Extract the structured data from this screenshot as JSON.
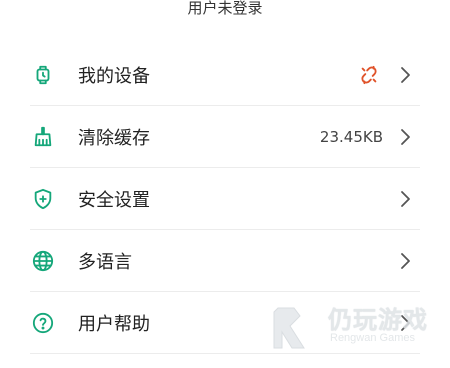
{
  "header": {
    "title": "用户未登录"
  },
  "menu": {
    "items": [
      {
        "label": "我的设备",
        "value": "",
        "icon": "watch-icon",
        "status_icon": "broken-link-icon"
      },
      {
        "label": "清除缓存",
        "value": "23.45KB",
        "icon": "broom-icon"
      },
      {
        "label": "安全设置",
        "value": "",
        "icon": "shield-icon"
      },
      {
        "label": "多语言",
        "value": "",
        "icon": "globe-icon"
      },
      {
        "label": "用户帮助",
        "value": "",
        "icon": "help-circle-icon"
      }
    ]
  },
  "watermark": {
    "main": "仍玩游戏",
    "sub": "Rengwan Games"
  },
  "colors": {
    "accent": "#15a77a",
    "status_broken": "#e0532a",
    "chevron": "#555555",
    "divider": "#ececec"
  }
}
